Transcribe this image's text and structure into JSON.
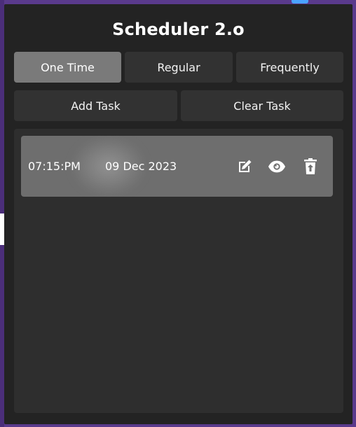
{
  "popup": {
    "title": "Scheduler 2.o"
  },
  "tabs": [
    {
      "label": "One Time",
      "active": true
    },
    {
      "label": "Regular",
      "active": false
    },
    {
      "label": "Frequently",
      "active": false
    }
  ],
  "actions": {
    "add_label": "Add Task",
    "clear_label": "Clear Task"
  },
  "tasks": [
    {
      "time": "07:15:PM",
      "date": "09 Dec 2023",
      "icons": [
        "edit-icon",
        "eye-icon",
        "trash-upload-icon"
      ]
    }
  ],
  "colors": {
    "popup_bg": "#232323",
    "button_bg": "#323232",
    "active_tab_bg": "#7a7a7a",
    "task_row_bg": "#6e6e6e",
    "page_bg": "#5a3a8c"
  }
}
